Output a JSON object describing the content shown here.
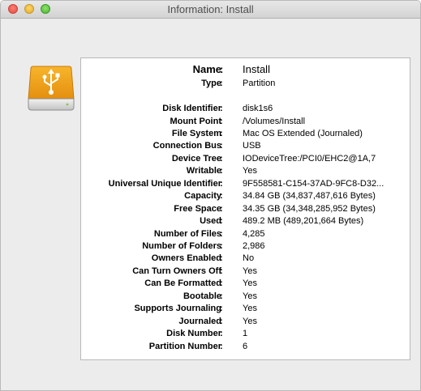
{
  "window": {
    "title": "Information: Install",
    "drive_icon": "usb-drive-icon",
    "icon_color": "#f0a31a"
  },
  "info": {
    "name": {
      "label": "Name",
      "value": "Install"
    },
    "type": {
      "label": "Type",
      "value": "Partition"
    },
    "rows": [
      {
        "label": "Disk Identifier",
        "value": "disk1s6"
      },
      {
        "label": "Mount Point",
        "value": "/Volumes/Install"
      },
      {
        "label": "File System",
        "value": "Mac OS Extended (Journaled)"
      },
      {
        "label": "Connection Bus",
        "value": "USB"
      },
      {
        "label": "Device Tree",
        "value": "IODeviceTree:/PCI0/EHC2@1A,7"
      },
      {
        "label": "Writable",
        "value": "Yes"
      },
      {
        "label": "Universal Unique Identifier",
        "value": "9F558581-C154-37AD-9FC8-D32..."
      },
      {
        "label": "Capacity",
        "value": "34.84 GB (34,837,487,616 Bytes)"
      },
      {
        "label": "Free Space",
        "value": "34.35 GB (34,348,285,952 Bytes)"
      },
      {
        "label": "Used",
        "value": "489.2 MB (489,201,664 Bytes)"
      },
      {
        "label": "Number of Files",
        "value": "4,285"
      },
      {
        "label": "Number of Folders",
        "value": "2,986"
      },
      {
        "label": "Owners Enabled",
        "value": "No"
      },
      {
        "label": "Can Turn Owners Off",
        "value": "Yes"
      },
      {
        "label": "Can Be Formatted",
        "value": "Yes"
      },
      {
        "label": "Bootable",
        "value": "Yes"
      },
      {
        "label": "Supports Journaling",
        "value": "Yes"
      },
      {
        "label": "Journaled",
        "value": "Yes"
      },
      {
        "label": "Disk Number",
        "value": "1"
      },
      {
        "label": "Partition Number",
        "value": "6"
      }
    ]
  }
}
